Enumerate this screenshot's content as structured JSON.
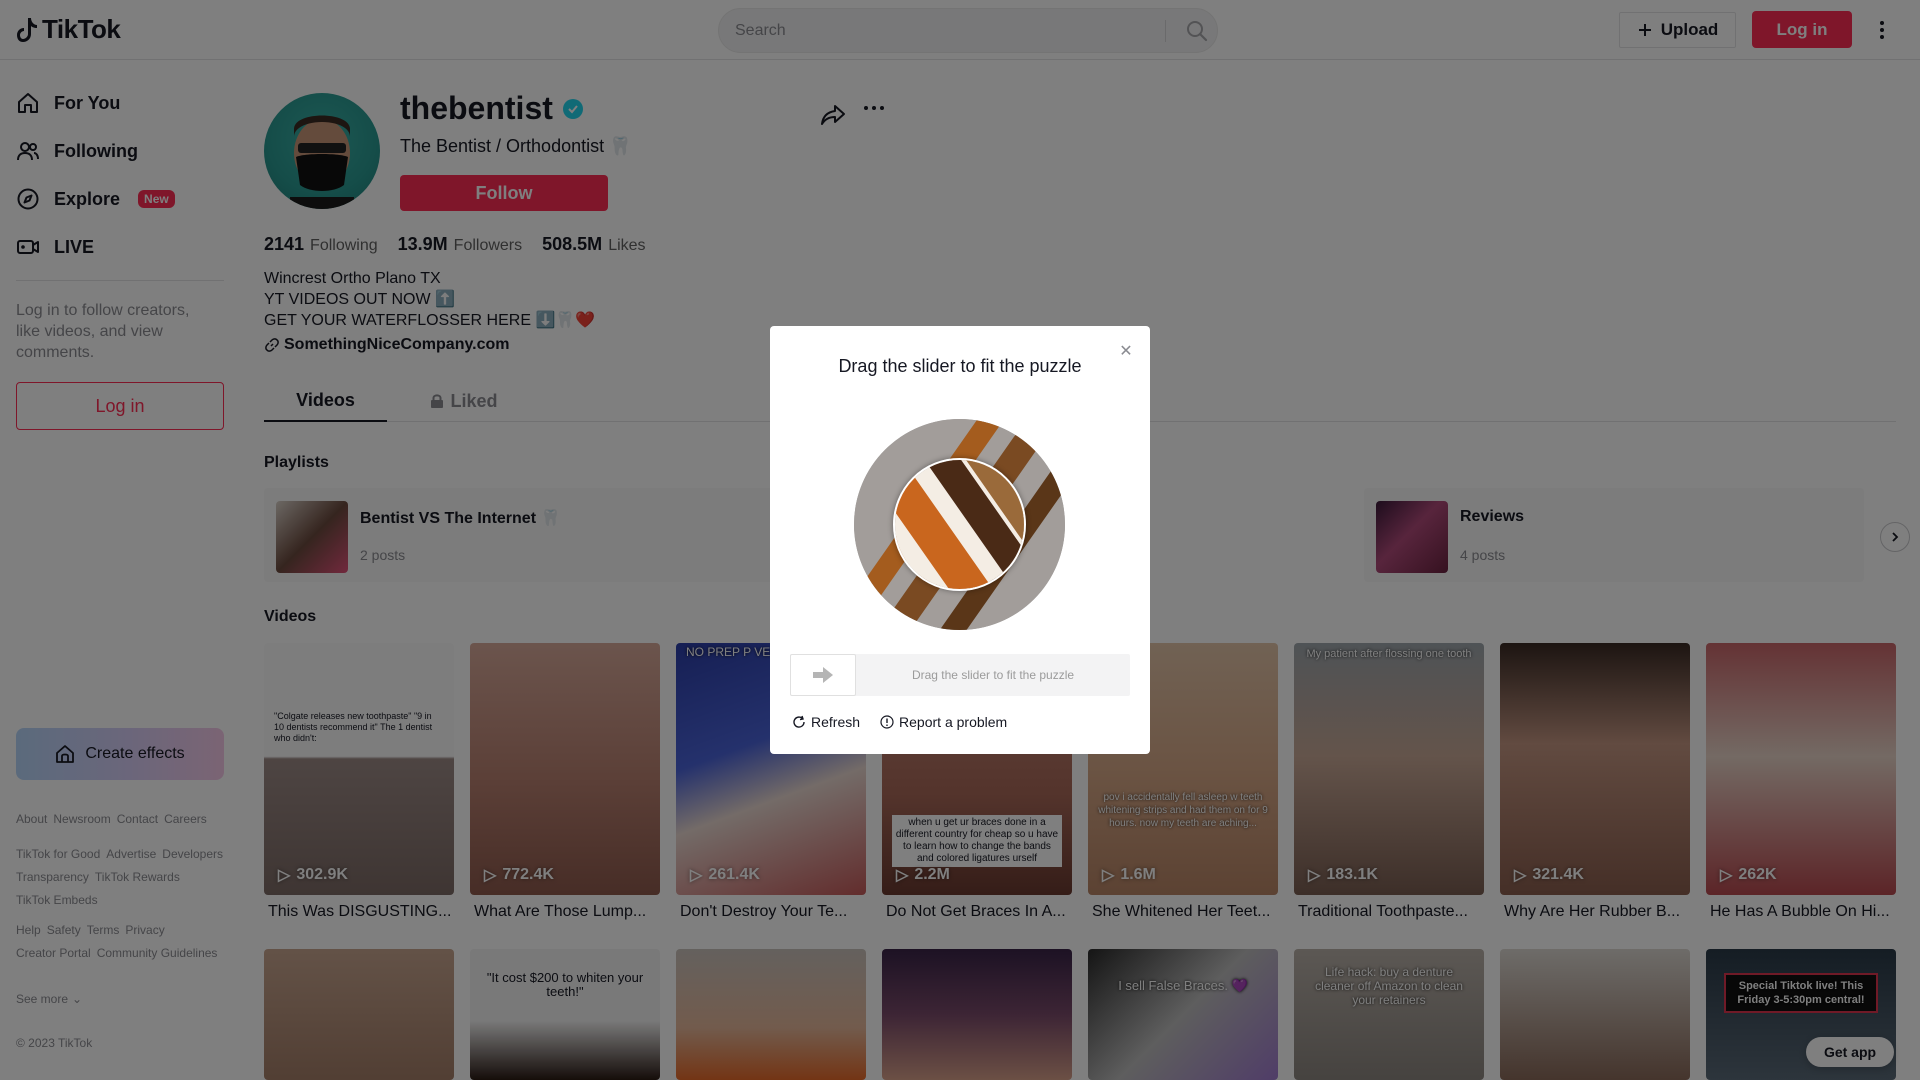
{
  "header": {
    "logo_text": "TikTok",
    "search_placeholder": "Search",
    "upload_label": "Upload",
    "login_label": "Log in"
  },
  "sidebar": {
    "nav": [
      {
        "label": "For You",
        "icon": "home-icon"
      },
      {
        "label": "Following",
        "icon": "following-icon"
      },
      {
        "label": "Explore",
        "icon": "explore-icon",
        "badge": "New"
      },
      {
        "label": "LIVE",
        "icon": "live-icon"
      }
    ],
    "login_prompt": "Log in to follow creators, like videos, and view comments.",
    "login_label": "Log in",
    "create_effects": "Create effects",
    "footer_groups": [
      [
        "About",
        "Newsroom",
        "Contact",
        "Careers"
      ],
      [
        "TikTok for Good",
        "Advertise",
        "Developers",
        "Transparency",
        "TikTok Rewards",
        "TikTok Embeds"
      ],
      [
        "Help",
        "Safety",
        "Terms",
        "Privacy",
        "Creator Portal",
        "Community Guidelines"
      ]
    ],
    "see_more": "See more",
    "copyright": "© 2023 TikTok"
  },
  "profile": {
    "username": "thebentist",
    "nickname": "The Bentist / Orthodontist 🦷",
    "follow_label": "Follow",
    "following_count": "2141",
    "following_label": "Following",
    "followers_count": "13.9M",
    "followers_label": "Followers",
    "likes_count": "508.5M",
    "likes_label": "Likes",
    "bio_lines": [
      "Wincrest Ortho Plano TX",
      "YT VIDEOS OUT NOW ⬆️",
      "GET YOUR WATERFLOSSER HERE ⬇️🦷❤️"
    ],
    "link": "SomethingNiceCompany.com"
  },
  "tabs": {
    "videos": "Videos",
    "liked": "Liked"
  },
  "playlists_title": "Playlists",
  "playlists": [
    {
      "name": "Bentist VS The Internet 🦷",
      "posts": "2 posts"
    },
    {
      "name": "Reviews",
      "posts": "4 posts"
    }
  ],
  "videos_title": "Videos",
  "videos": [
    {
      "views": "302.9K",
      "title": "This Was DISGUSTING...",
      "overlay": "\"Colgate releases new toothpaste\" \"9 in 10 dentists recommend it\" The 1 dentist who didn't:"
    },
    {
      "views": "772.4K",
      "title": "What Are Those Lump...",
      "overlay": ""
    },
    {
      "views": "261.4K",
      "title": "Don't Destroy Your Te...",
      "overlay": "NO PREP P VENI"
    },
    {
      "views": "2.2M",
      "title": "Do Not Get Braces In A...",
      "overlay": "when u get ur braces done in a different country for cheap so u have to learn how to change the bands and colored ligatures urself"
    },
    {
      "views": "1.6M",
      "title": "She Whitened Her Teet...",
      "overlay": "pov i accidentally fell asleep w teeth whitening strips and had them on for 9 hours. now my teeth are aching..."
    },
    {
      "views": "183.1K",
      "title": "Traditional Toothpaste...",
      "overlay": "My patient after flossing one tooth"
    },
    {
      "views": "321.4K",
      "title": "Why Are Her Rubber B...",
      "overlay": ""
    },
    {
      "views": "262K",
      "title": "He Has A Bubble On Hi...",
      "overlay": ""
    }
  ],
  "videos_row2": [
    {
      "overlay": ""
    },
    {
      "overlay": "\"It cost $200 to whiten your teeth!\""
    },
    {
      "overlay": ""
    },
    {
      "overlay": ""
    },
    {
      "overlay": "I sell False Braces. 💜"
    },
    {
      "overlay": "Life hack: buy a denture cleaner off Amazon to clean your retainers"
    },
    {
      "overlay": ""
    },
    {
      "overlay": "Special Tiktok live! This Friday 3-5:30pm central!"
    }
  ],
  "get_app": "Get app",
  "captcha": {
    "title": "Drag the slider to fit the puzzle",
    "slider_hint": "Drag the slider to fit the puzzle",
    "refresh_label": "Refresh",
    "report_label": "Report a problem"
  },
  "colors": {
    "brand": "#fe2c55",
    "verified": "#20d5ec",
    "text": "#161823",
    "muted": "#8a8b91"
  }
}
